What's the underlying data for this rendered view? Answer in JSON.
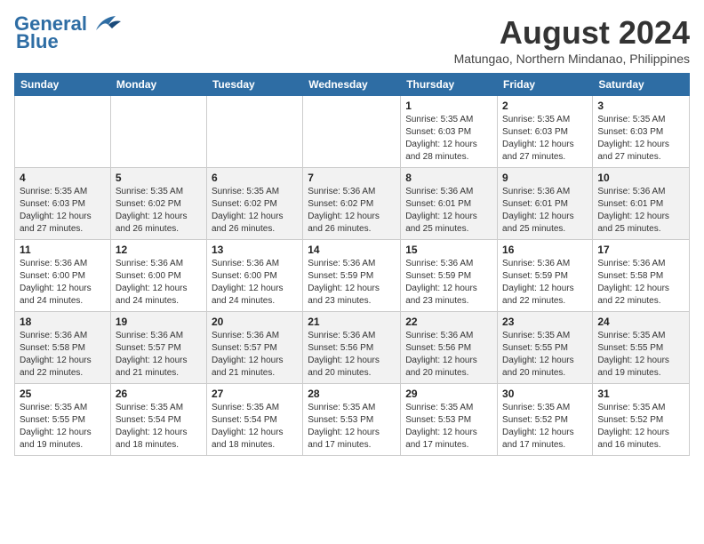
{
  "header": {
    "logo_line1": "General",
    "logo_line2": "Blue",
    "month_year": "August 2024",
    "location": "Matungao, Northern Mindanao, Philippines"
  },
  "days_of_week": [
    "Sunday",
    "Monday",
    "Tuesday",
    "Wednesday",
    "Thursday",
    "Friday",
    "Saturday"
  ],
  "weeks": [
    [
      {
        "day": "",
        "info": ""
      },
      {
        "day": "",
        "info": ""
      },
      {
        "day": "",
        "info": ""
      },
      {
        "day": "",
        "info": ""
      },
      {
        "day": "1",
        "info": "Sunrise: 5:35 AM\nSunset: 6:03 PM\nDaylight: 12 hours\nand 28 minutes."
      },
      {
        "day": "2",
        "info": "Sunrise: 5:35 AM\nSunset: 6:03 PM\nDaylight: 12 hours\nand 27 minutes."
      },
      {
        "day": "3",
        "info": "Sunrise: 5:35 AM\nSunset: 6:03 PM\nDaylight: 12 hours\nand 27 minutes."
      }
    ],
    [
      {
        "day": "4",
        "info": "Sunrise: 5:35 AM\nSunset: 6:03 PM\nDaylight: 12 hours\nand 27 minutes."
      },
      {
        "day": "5",
        "info": "Sunrise: 5:35 AM\nSunset: 6:02 PM\nDaylight: 12 hours\nand 26 minutes."
      },
      {
        "day": "6",
        "info": "Sunrise: 5:35 AM\nSunset: 6:02 PM\nDaylight: 12 hours\nand 26 minutes."
      },
      {
        "day": "7",
        "info": "Sunrise: 5:36 AM\nSunset: 6:02 PM\nDaylight: 12 hours\nand 26 minutes."
      },
      {
        "day": "8",
        "info": "Sunrise: 5:36 AM\nSunset: 6:01 PM\nDaylight: 12 hours\nand 25 minutes."
      },
      {
        "day": "9",
        "info": "Sunrise: 5:36 AM\nSunset: 6:01 PM\nDaylight: 12 hours\nand 25 minutes."
      },
      {
        "day": "10",
        "info": "Sunrise: 5:36 AM\nSunset: 6:01 PM\nDaylight: 12 hours\nand 25 minutes."
      }
    ],
    [
      {
        "day": "11",
        "info": "Sunrise: 5:36 AM\nSunset: 6:00 PM\nDaylight: 12 hours\nand 24 minutes."
      },
      {
        "day": "12",
        "info": "Sunrise: 5:36 AM\nSunset: 6:00 PM\nDaylight: 12 hours\nand 24 minutes."
      },
      {
        "day": "13",
        "info": "Sunrise: 5:36 AM\nSunset: 6:00 PM\nDaylight: 12 hours\nand 24 minutes."
      },
      {
        "day": "14",
        "info": "Sunrise: 5:36 AM\nSunset: 5:59 PM\nDaylight: 12 hours\nand 23 minutes."
      },
      {
        "day": "15",
        "info": "Sunrise: 5:36 AM\nSunset: 5:59 PM\nDaylight: 12 hours\nand 23 minutes."
      },
      {
        "day": "16",
        "info": "Sunrise: 5:36 AM\nSunset: 5:59 PM\nDaylight: 12 hours\nand 22 minutes."
      },
      {
        "day": "17",
        "info": "Sunrise: 5:36 AM\nSunset: 5:58 PM\nDaylight: 12 hours\nand 22 minutes."
      }
    ],
    [
      {
        "day": "18",
        "info": "Sunrise: 5:36 AM\nSunset: 5:58 PM\nDaylight: 12 hours\nand 22 minutes."
      },
      {
        "day": "19",
        "info": "Sunrise: 5:36 AM\nSunset: 5:57 PM\nDaylight: 12 hours\nand 21 minutes."
      },
      {
        "day": "20",
        "info": "Sunrise: 5:36 AM\nSunset: 5:57 PM\nDaylight: 12 hours\nand 21 minutes."
      },
      {
        "day": "21",
        "info": "Sunrise: 5:36 AM\nSunset: 5:56 PM\nDaylight: 12 hours\nand 20 minutes."
      },
      {
        "day": "22",
        "info": "Sunrise: 5:36 AM\nSunset: 5:56 PM\nDaylight: 12 hours\nand 20 minutes."
      },
      {
        "day": "23",
        "info": "Sunrise: 5:35 AM\nSunset: 5:55 PM\nDaylight: 12 hours\nand 20 minutes."
      },
      {
        "day": "24",
        "info": "Sunrise: 5:35 AM\nSunset: 5:55 PM\nDaylight: 12 hours\nand 19 minutes."
      }
    ],
    [
      {
        "day": "25",
        "info": "Sunrise: 5:35 AM\nSunset: 5:55 PM\nDaylight: 12 hours\nand 19 minutes."
      },
      {
        "day": "26",
        "info": "Sunrise: 5:35 AM\nSunset: 5:54 PM\nDaylight: 12 hours\nand 18 minutes."
      },
      {
        "day": "27",
        "info": "Sunrise: 5:35 AM\nSunset: 5:54 PM\nDaylight: 12 hours\nand 18 minutes."
      },
      {
        "day": "28",
        "info": "Sunrise: 5:35 AM\nSunset: 5:53 PM\nDaylight: 12 hours\nand 17 minutes."
      },
      {
        "day": "29",
        "info": "Sunrise: 5:35 AM\nSunset: 5:53 PM\nDaylight: 12 hours\nand 17 minutes."
      },
      {
        "day": "30",
        "info": "Sunrise: 5:35 AM\nSunset: 5:52 PM\nDaylight: 12 hours\nand 17 minutes."
      },
      {
        "day": "31",
        "info": "Sunrise: 5:35 AM\nSunset: 5:52 PM\nDaylight: 12 hours\nand 16 minutes."
      }
    ]
  ]
}
